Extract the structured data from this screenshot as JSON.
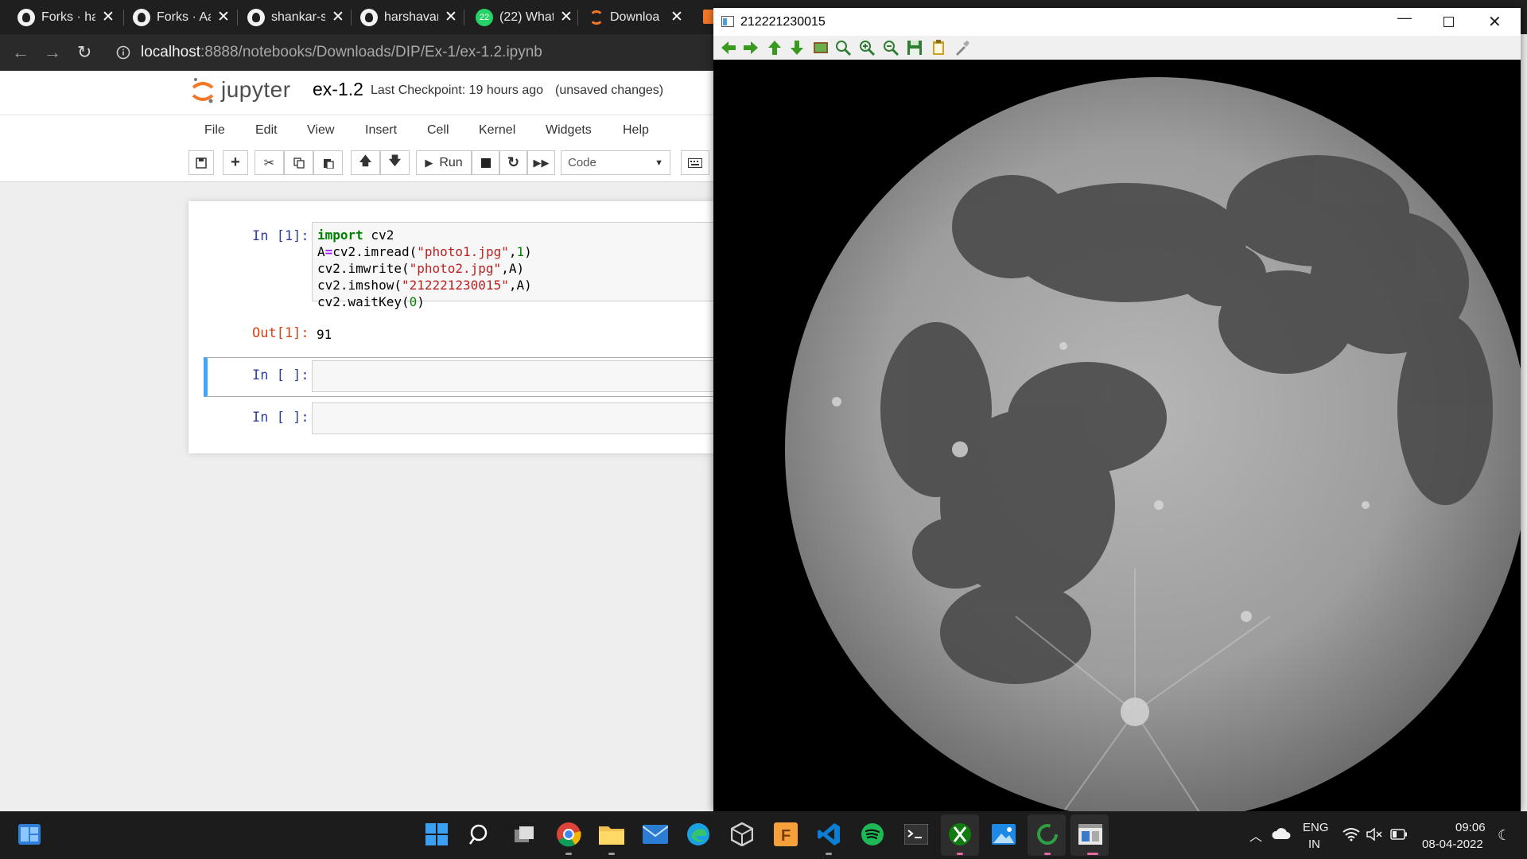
{
  "browser": {
    "tabs": [
      {
        "title": "Forks · ha"
      },
      {
        "title": "Forks · Aa"
      },
      {
        "title": "shankar-s"
      },
      {
        "title": "harshavar"
      },
      {
        "title": "(22) What"
      },
      {
        "title": "Downloa"
      }
    ],
    "whatsapp_badge": "22",
    "url_host": "localhost",
    "url_path": ":8888/notebooks/Downloads/DIP/Ex-1/ex-1.2.ipynb"
  },
  "jupyter": {
    "logo_text": "jupyter",
    "notebook_name": "ex-1.2",
    "checkpoint": "Last Checkpoint: 19 hours ago",
    "status": "(unsaved changes)",
    "menu": [
      "File",
      "Edit",
      "View",
      "Insert",
      "Cell",
      "Kernel",
      "Widgets",
      "Help"
    ],
    "run_label": "Run",
    "cell_type": "Code",
    "cells": {
      "c1_prompt": "In [1]:",
      "c1_line1_kw": "import",
      "c1_line1_rest": " cv2",
      "c1_line2_a": "A",
      "c1_line2_eq": "=",
      "c1_line2_b": "cv2.imread(",
      "c1_line2_str": "\"photo1.jpg\"",
      "c1_line2_c": ",",
      "c1_line2_num": "1",
      "c1_line2_d": ")",
      "c1_line3_a": "cv2.imwrite(",
      "c1_line3_str": "\"photo2.jpg\"",
      "c1_line3_b": ",A)",
      "c1_line4_a": "cv2.imshow(",
      "c1_line4_str": "\"212221230015\"",
      "c1_line4_b": ",A)",
      "c1_line5_a": "cv2.waitKey(",
      "c1_line5_num": "0",
      "c1_line5_b": ")",
      "out_prompt": "Out[1]:",
      "out_value": "91",
      "c2_prompt": "In [ ]:",
      "c3_prompt": "In [ ]:"
    }
  },
  "cv_window": {
    "title": "212221230015"
  },
  "taskbar": {
    "lang_top": "ENG",
    "lang_bottom": "IN",
    "time": "09:06",
    "date": "08-04-2022"
  },
  "colors": {
    "jupyter_orange": "#f37726",
    "selected_cell": "#42a5f5",
    "prompt_in": "#303f9f",
    "prompt_out": "#d84315"
  }
}
